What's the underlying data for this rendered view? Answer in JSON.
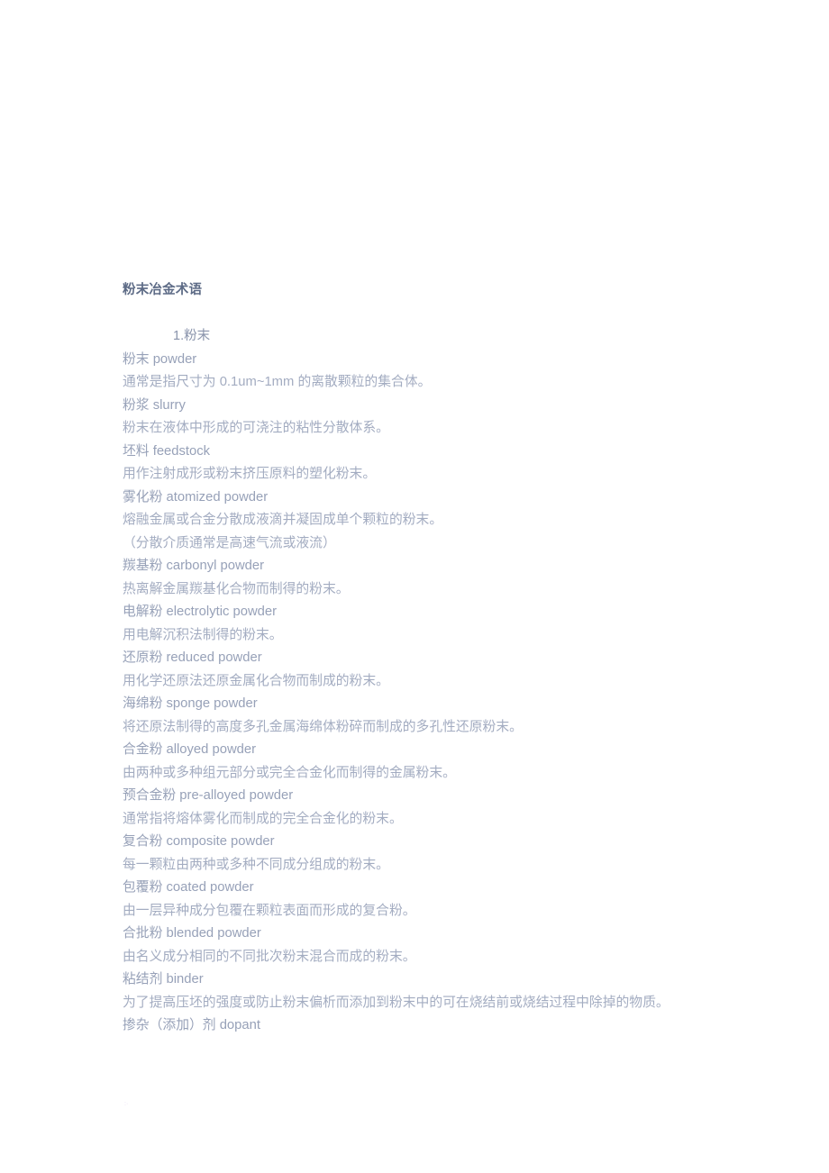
{
  "document": {
    "title": "粉末冶金术语",
    "section_heading": "1.粉末",
    "entries": [
      {
        "term": "粉末 powder",
        "definition": "通常是指尺寸为 0.1um~1mm 的离散颗粒的集合体。"
      },
      {
        "term": "粉浆 slurry",
        "definition": "粉末在液体中形成的可浇注的粘性分散体系。"
      },
      {
        "term": "坯料 feedstock",
        "definition": "用作注射成形或粉末挤压原料的塑化粉末。"
      },
      {
        "term": "雾化粉 atomized powder",
        "definition": "熔融金属或合金分散成液滴并凝固成单个颗粒的粉末。",
        "definition_extra": "（分散介质通常是高速气流或液流）"
      },
      {
        "term": "羰基粉 carbonyl powder",
        "definition": "热离解金属羰基化合物而制得的粉末。"
      },
      {
        "term": "电解粉 electrolytic powder",
        "definition": "用电解沉积法制得的粉末。"
      },
      {
        "term": "还原粉 reduced powder",
        "definition": "用化学还原法还原金属化合物而制成的粉末。"
      },
      {
        "term": "海绵粉 sponge powder",
        "definition": "将还原法制得的高度多孔金属海绵体粉碎而制成的多孔性还原粉末。"
      },
      {
        "term": "合金粉 alloyed powder",
        "definition": "由两种或多种组元部分或完全合金化而制得的金属粉末。"
      },
      {
        "term": "预合金粉 pre-alloyed powder",
        "definition": "通常指将熔体雾化而制成的完全合金化的粉末。"
      },
      {
        "term": "复合粉 composite powder",
        "definition": "每一颗粒由两种或多种不同成分组成的粉末。"
      },
      {
        "term": "包覆粉 coated powder",
        "definition": "由一层异种成分包覆在颗粒表面而形成的复合粉。"
      },
      {
        "term": "合批粉 blended powder",
        "definition": "由名义成分相同的不同批次粉末混合而成的粉末。"
      },
      {
        "term": "粘结剂 binder",
        "definition": "为了提高压坯的强度或防止粉末偏析而添加到粉末中的可在烧结前或烧结过程中除掉的物质。"
      },
      {
        "term": "掺杂（添加）剂 dopant",
        "definition": ""
      }
    ]
  },
  "colors": {
    "title": "#5d6b86",
    "term": "#97a1b8",
    "definition": "#a3acc1",
    "background": "#ffffff"
  }
}
